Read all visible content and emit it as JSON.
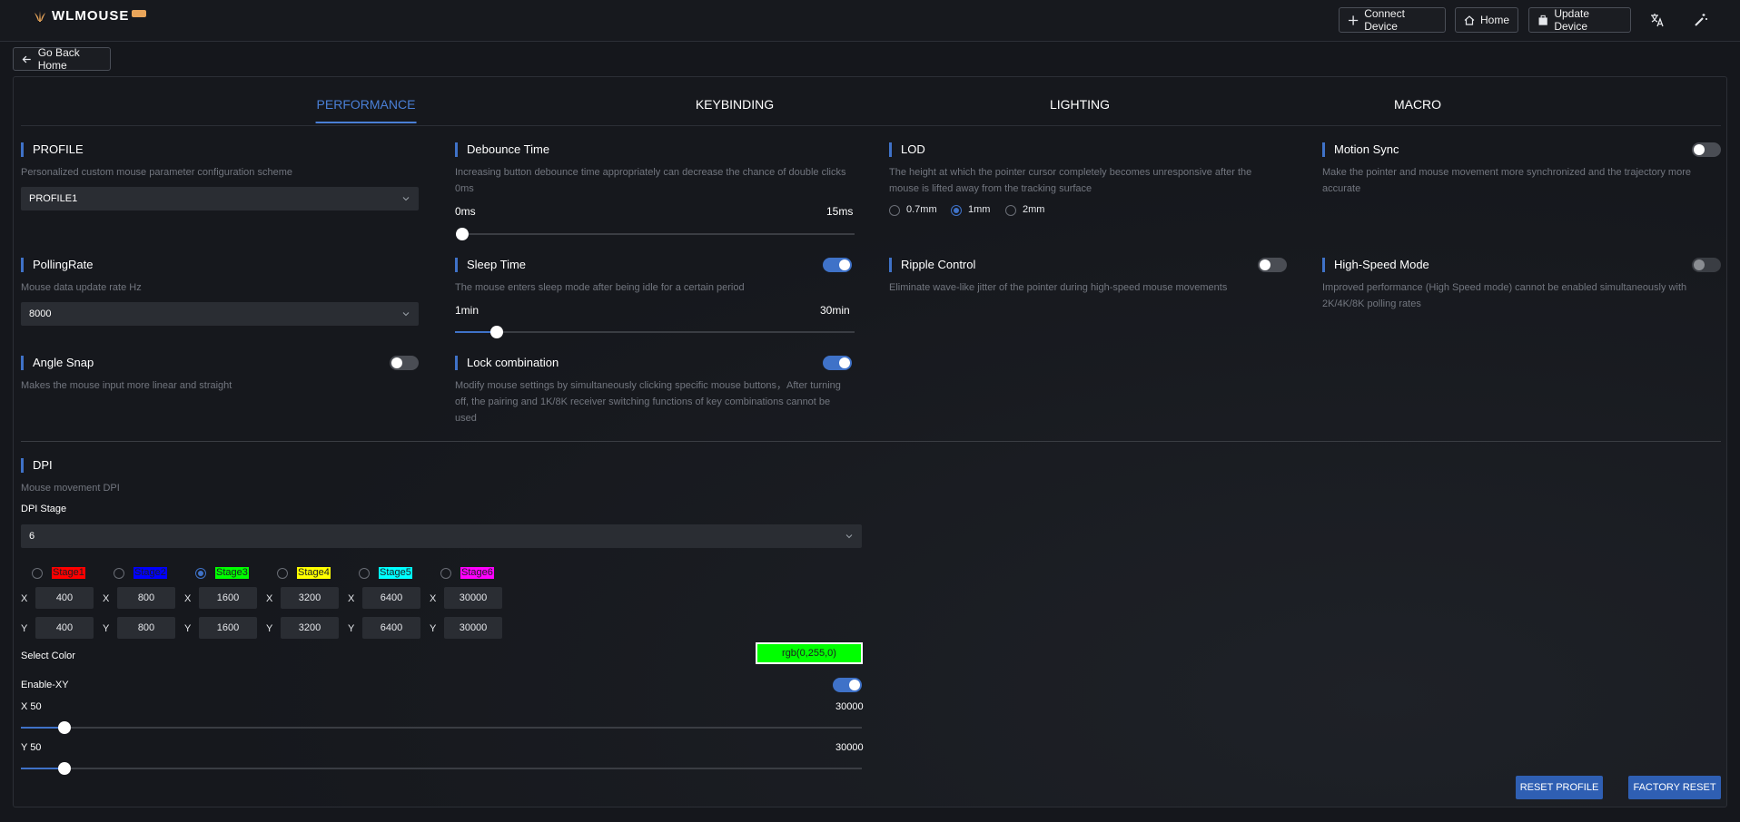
{
  "app": {
    "brand": "WLMOUSE"
  },
  "topbar": {
    "connect_label": "Connect Device",
    "home_label": "Home",
    "update_label": "Update Device"
  },
  "back_label": "Go Back Home",
  "tabs": [
    {
      "label": "PERFORMANCE",
      "active": true
    },
    {
      "label": "KEYBINDING",
      "active": false
    },
    {
      "label": "LIGHTING",
      "active": false
    },
    {
      "label": "MACRO",
      "active": false
    }
  ],
  "profile": {
    "title": "PROFILE",
    "desc": "Personalized custom mouse parameter configuration scheme",
    "value": "PROFILE1"
  },
  "debounce": {
    "title": "Debounce Time",
    "desc1": "Increasing button debounce time appropriately can decrease the chance of double clicks",
    "desc2": "0ms",
    "min": "0ms",
    "max": "15ms",
    "value": 0,
    "range": [
      0,
      15
    ]
  },
  "lod": {
    "title": "LOD",
    "desc1": "The height at which the pointer cursor completely becomes unresponsive after the",
    "desc2": "mouse is lifted away from the tracking surface",
    "options": [
      "0.7mm",
      "1mm",
      "2mm"
    ],
    "selected": "1mm"
  },
  "motion_sync": {
    "title": "Motion Sync",
    "desc1": "Make the pointer and mouse movement more synchronized and the trajectory more",
    "desc2": "accurate",
    "enabled": false
  },
  "polling": {
    "title": "PollingRate",
    "desc": "Mouse data update rate Hz",
    "value": "8000"
  },
  "sleep": {
    "title": "Sleep Time",
    "desc": "The mouse enters sleep mode after being idle for a certain period",
    "min": "1min",
    "max": "30min",
    "value": 4,
    "range": [
      1,
      30
    ],
    "enabled": true
  },
  "ripple": {
    "title": "Ripple Control",
    "desc": "Eliminate wave-like jitter of the pointer during high-speed mouse movements",
    "enabled": false
  },
  "high_speed": {
    "title": "High-Speed Mode",
    "desc1": "Improved performance (High Speed mode) cannot be enabled simultaneously with",
    "desc2": "2K/4K/8K polling rates",
    "enabled": false,
    "disabled": true
  },
  "angle_snap": {
    "title": "Angle Snap",
    "desc": "Makes the mouse input more linear and straight",
    "enabled": false
  },
  "lock_combo": {
    "title": "Lock combination",
    "desc1": "Modify mouse settings by simultaneously clicking specific mouse buttons，After turning",
    "desc2": "off, the pairing and 1K/8K receiver switching functions of key combinations cannot be",
    "desc3": "used",
    "enabled": true
  },
  "dpi": {
    "title": "DPI",
    "desc": "Mouse movement DPI",
    "stage_label": "DPI Stage",
    "stage_count": "6",
    "x_label": "X",
    "y_label": "Y",
    "stages": [
      {
        "name": "Stage1",
        "color": "#ff0000",
        "text_color": "#1b1d22",
        "x": "400",
        "y": "400",
        "selected": false
      },
      {
        "name": "Stage2",
        "color": "#0000ff",
        "text_color": "#1b1d22",
        "x": "800",
        "y": "800",
        "selected": false
      },
      {
        "name": "Stage3",
        "color": "#00ff00",
        "text_color": "#1b1d22",
        "x": "1600",
        "y": "1600",
        "selected": true
      },
      {
        "name": "Stage4",
        "color": "#ffff00",
        "text_color": "#1b1d22",
        "x": "3200",
        "y": "3200",
        "selected": false
      },
      {
        "name": "Stage5",
        "color": "#00ffff",
        "text_color": "#1b1d22",
        "x": "6400",
        "y": "6400",
        "selected": false
      },
      {
        "name": "Stage6",
        "color": "#ff00ff",
        "text_color": "#1b1d22",
        "x": "30000",
        "y": "30000",
        "selected": false
      }
    ],
    "select_color_label": "Select Color",
    "color_value": "rgb(0,255,0)",
    "enable_xy_label": "Enable-XY",
    "enable_xy": true,
    "x_slider_label": "X 50",
    "x_slider_max": "30000",
    "x_slider_value": 1600,
    "y_slider_label": "Y 50",
    "y_slider_max": "30000",
    "y_slider_value": 1600,
    "slider_range": [
      50,
      30000
    ]
  },
  "buttons": {
    "reset_profile": "RESET PROFILE",
    "factory_reset": "FACTORY RESET"
  },
  "colors": {
    "accent": "#3f72c8",
    "tab_active": "#4a7fd6"
  }
}
